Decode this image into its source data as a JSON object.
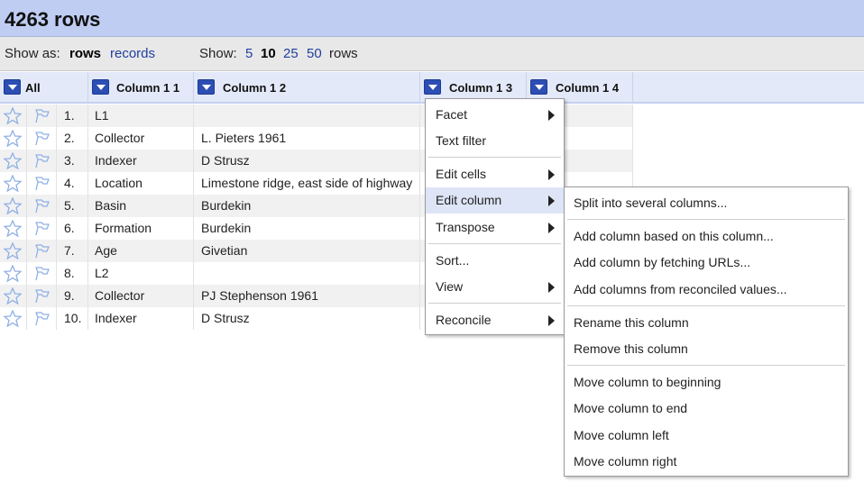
{
  "title": "4263 rows",
  "show_as": {
    "label": "Show as:",
    "rows": "rows",
    "records": "records"
  },
  "show": {
    "label": "Show:",
    "options": [
      "5",
      "10",
      "25",
      "50"
    ],
    "active": "10",
    "suffix": "rows"
  },
  "columns": [
    {
      "label": "All"
    },
    {
      "label": "Column 1 1"
    },
    {
      "label": "Column 1 2"
    },
    {
      "label": "Column 1 3"
    },
    {
      "label": "Column 1 4"
    }
  ],
  "rows": [
    {
      "num": "1.",
      "c1": "L1",
      "c2": ""
    },
    {
      "num": "2.",
      "c1": "Collector",
      "c2": "L. Pieters 1961"
    },
    {
      "num": "3.",
      "c1": "Indexer",
      "c2": "D Strusz"
    },
    {
      "num": "4.",
      "c1": "Location",
      "c2": "Limestone ridge, east side of highway"
    },
    {
      "num": "5.",
      "c1": "Basin",
      "c2": "Burdekin"
    },
    {
      "num": "6.",
      "c1": "Formation",
      "c2": "Burdekin"
    },
    {
      "num": "7.",
      "c1": "Age",
      "c2": "Givetian"
    },
    {
      "num": "8.",
      "c1": "L2",
      "c2": ""
    },
    {
      "num": "9.",
      "c1": "Collector",
      "c2": "PJ Stephenson 1961"
    },
    {
      "num": "10.",
      "c1": "Indexer",
      "c2": "D Strusz"
    }
  ],
  "column_menu": [
    {
      "label": "Facet",
      "submenu": true
    },
    {
      "label": "Text filter",
      "submenu": false
    },
    {
      "label": "Edit cells",
      "submenu": true
    },
    {
      "label": "Edit column",
      "submenu": true,
      "highlighted": true
    },
    {
      "label": "Transpose",
      "submenu": true
    },
    {
      "label": "Sort...",
      "submenu": false
    },
    {
      "label": "View",
      "submenu": true
    },
    {
      "label": "Reconcile",
      "submenu": true
    }
  ],
  "edit_column_submenu": [
    "Split into several columns...",
    "Add column based on this column...",
    "Add column by fetching URLs...",
    "Add columns from reconciled values...",
    "Rename this column",
    "Remove this column",
    "Move column to beginning",
    "Move column to end",
    "Move column left",
    "Move column right"
  ],
  "colors": {
    "header_bar": "#bfcdf3",
    "link": "#1f3f9f",
    "dropdown_button": "#2d4fb3",
    "menu_highlight": "#dde5f6"
  },
  "icons": {
    "star": "star-icon",
    "flag": "flag-icon",
    "dropdown": "dropdown-arrow-icon",
    "submenu": "submenu-arrow-icon"
  }
}
